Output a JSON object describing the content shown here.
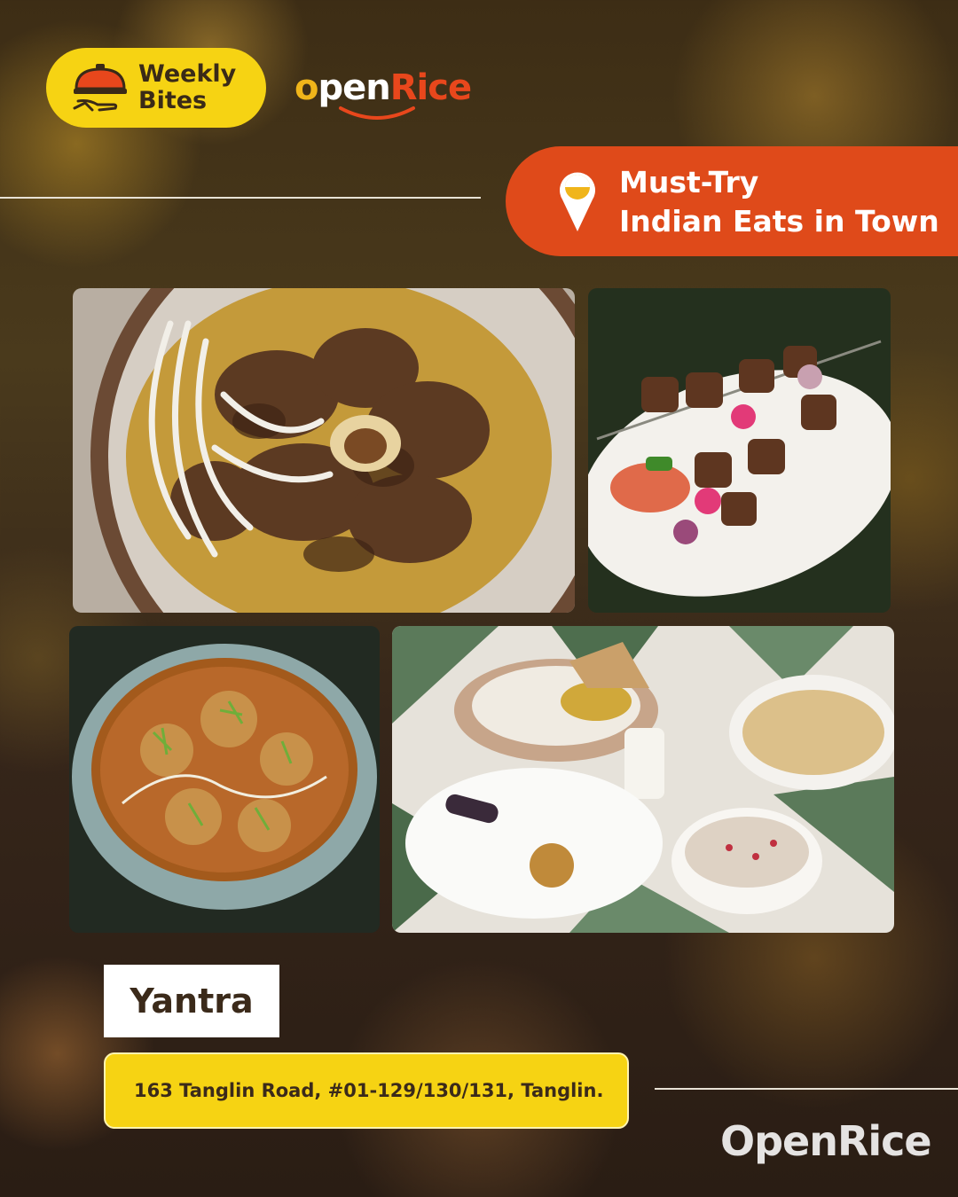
{
  "header": {
    "badge": {
      "line1": "Weekly",
      "line2": "Bites",
      "icon": "cloche-hand-icon"
    },
    "brand": {
      "o": "o",
      "pen": "pen",
      "rice": "Rice"
    }
  },
  "tag": {
    "line1": "Must-Try",
    "line2": "Indian Eats in Town",
    "icon": "location-pin-icon"
  },
  "photos": [
    {
      "name": "mutton-curry-photo"
    },
    {
      "name": "kebab-skewer-photo"
    },
    {
      "name": "kofta-curry-photo"
    },
    {
      "name": "thali-spread-photo"
    }
  ],
  "restaurant": {
    "name": "Yantra",
    "address": "163 Tanglin Road, #01-129/130/131, Tanglin."
  },
  "footer": {
    "logo": "OpenRice"
  },
  "colors": {
    "yellow": "#f6d313",
    "orange": "#df4a1a",
    "dark": "#3b2a1a"
  }
}
